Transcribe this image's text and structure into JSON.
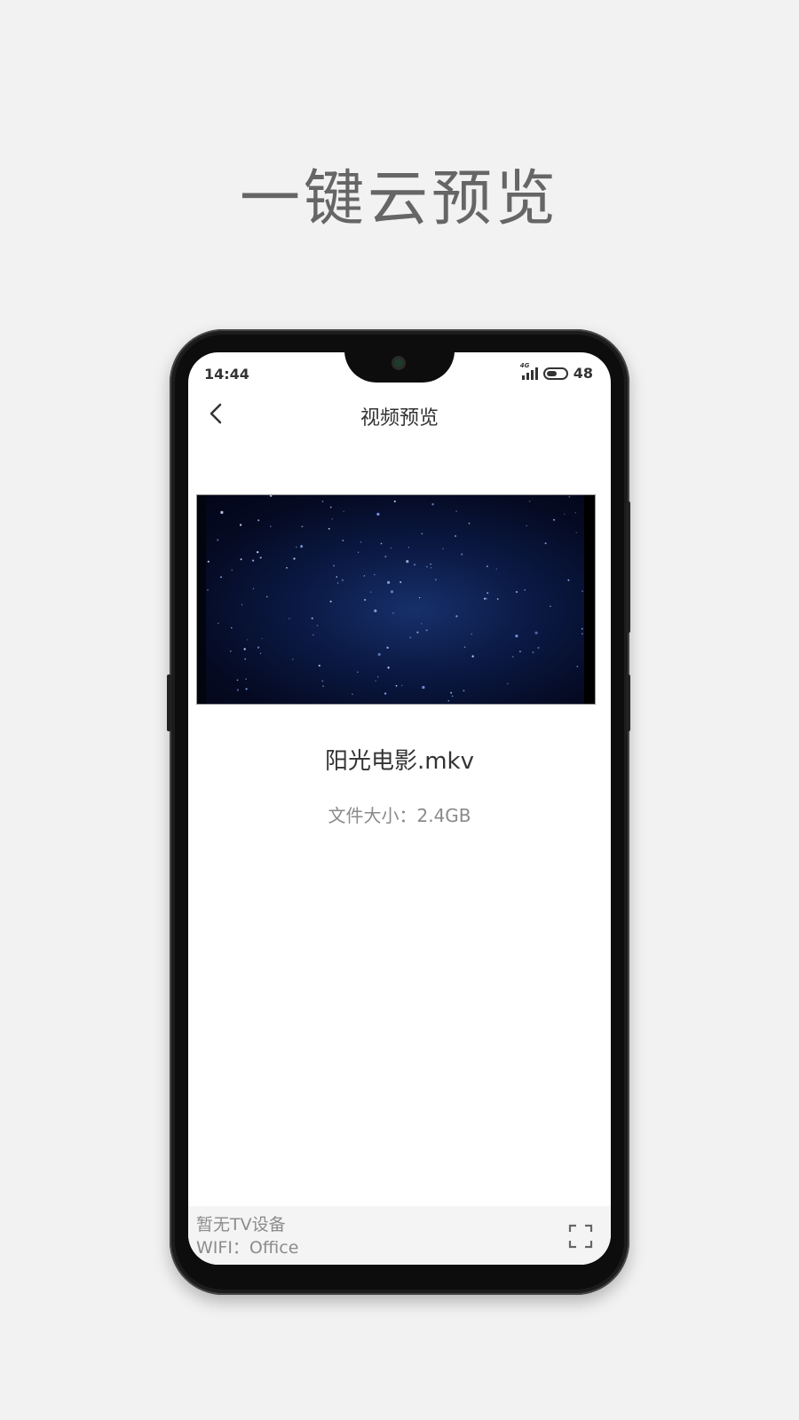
{
  "headline": "一键云预览",
  "status_bar": {
    "time": "14:44",
    "network": "4G",
    "battery_level": "48",
    "battery_fraction": 0.55
  },
  "nav": {
    "title": "视频预览",
    "back_icon": "chevron-left-icon"
  },
  "file": {
    "name": "阳光电影.mkv",
    "size_label": "文件大小：2.4GB"
  },
  "bottom_bar": {
    "tv_status": "暂无TV设备",
    "wifi": "WIFI：Office",
    "expand_icon": "fullscreen-icon"
  },
  "colors": {
    "page_bg": "#f2f2f2",
    "headline": "#666666",
    "phone_frame": "#1c1c1c",
    "video_bg": "#0a1842"
  }
}
